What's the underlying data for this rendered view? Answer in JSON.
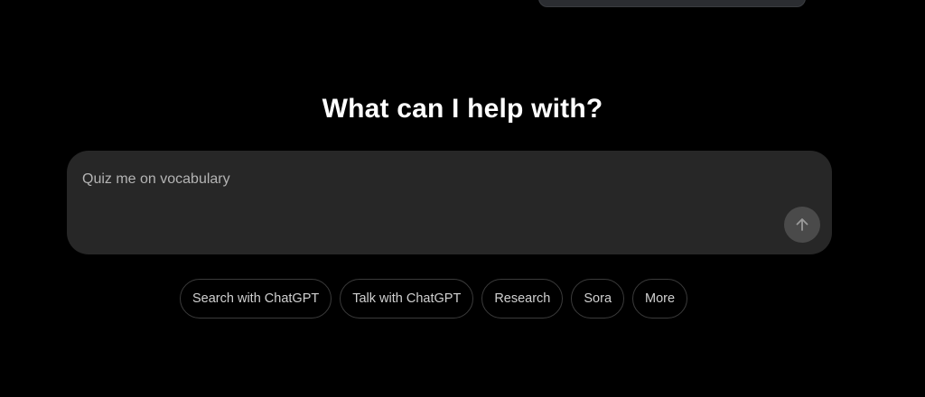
{
  "headline": "What can I help with?",
  "composer": {
    "placeholder": "Quiz me on vocabulary",
    "value": "",
    "send_icon": "arrow-up-icon"
  },
  "chips": [
    {
      "label": "Search with ChatGPT"
    },
    {
      "label": "Talk with ChatGPT"
    },
    {
      "label": "Research"
    },
    {
      "label": "Sora"
    },
    {
      "label": "More"
    }
  ],
  "colors": {
    "background": "#000000",
    "composer_bg": "#272727",
    "send_button_bg": "#4a4a4a",
    "chip_border": "#3b3b3b",
    "headline_text": "#ffffff",
    "chip_text": "#d0d0d0"
  }
}
